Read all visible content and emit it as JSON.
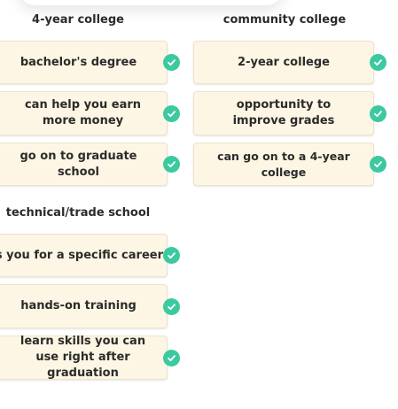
{
  "columns": [
    {
      "heading": "4-year college",
      "cards": [
        {
          "label": "bachelor's degree",
          "correct": true
        },
        {
          "label": "can help you earn more money",
          "correct": true
        },
        {
          "label": "go on to graduate school",
          "correct": true
        }
      ]
    },
    {
      "heading": "community college",
      "cards": [
        {
          "label": "2-year college",
          "correct": true
        },
        {
          "label": "opportunity to improve grades",
          "correct": true
        },
        {
          "label": "can go on to a 4-year college",
          "correct": true
        }
      ]
    },
    {
      "heading": "technical/trade school",
      "cards": [
        {
          "label": "trains you for a specific career",
          "correct": true
        },
        {
          "label": "hands-on training",
          "correct": true
        },
        {
          "label": "learn skills you can use right after graduation",
          "correct": true
        }
      ]
    }
  ],
  "colors": {
    "card_background": "#fdf6e4",
    "check_green": "#3cc9a0"
  },
  "icons": {
    "check": "check-circle-icon"
  }
}
